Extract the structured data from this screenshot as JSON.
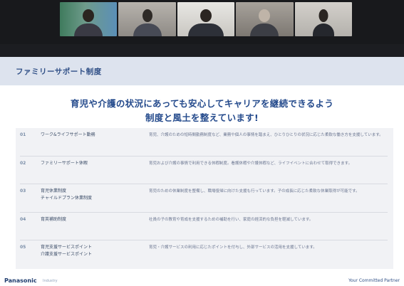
{
  "participants": [
    {
      "label": "participant-1"
    },
    {
      "label": "participant-2"
    },
    {
      "label": "participant-3"
    },
    {
      "label": "participant-4"
    },
    {
      "label": "participant-5"
    }
  ],
  "slide": {
    "header_title": "ファミリーサポート制度",
    "headline_line1": "育児や介護の状況にあっても安心してキャリアを継続できるよう",
    "headline_line2": "制度と風土を整えています!",
    "rows": [
      {
        "num": "01",
        "name": "ワーク&ライフサポート勤務",
        "desc": "育児、介護のための短時間勤務制度など、業務や個人の事情を踏まえ、ひとりひとりの状況に応じた柔軟な働き方を支援しています。"
      },
      {
        "num": "02",
        "name": "ファミリーサポート休暇",
        "desc": "育児および介護の事情で利用できる休暇制度。看護休暇や介護休暇など、ライフイベントに合わせて取得できます。"
      },
      {
        "num": "03",
        "name": "育児休業制度\nチャイルドプラン休業制度",
        "desc": "育児のための休業制度を整備し、職場復帰に向けた支援も行っています。子の成長に応じた柔軟な休業取得が可能です。"
      },
      {
        "num": "04",
        "name": "育英補助制度",
        "desc": "社員の子の教育や育成を支援するための補助を行い、家庭の経済的な負担を軽減しています。"
      },
      {
        "num": "05",
        "name": "育児支援サービスポイント\n介護支援サービスポイント",
        "desc": "育児・介護サービスの利用に応じたポイントを付与し、外部サービスの活用を支援しています。"
      }
    ]
  },
  "footer": {
    "logo": "Panasonic",
    "brand_sub": "Industry",
    "tagline": "Your Committed Partner"
  }
}
